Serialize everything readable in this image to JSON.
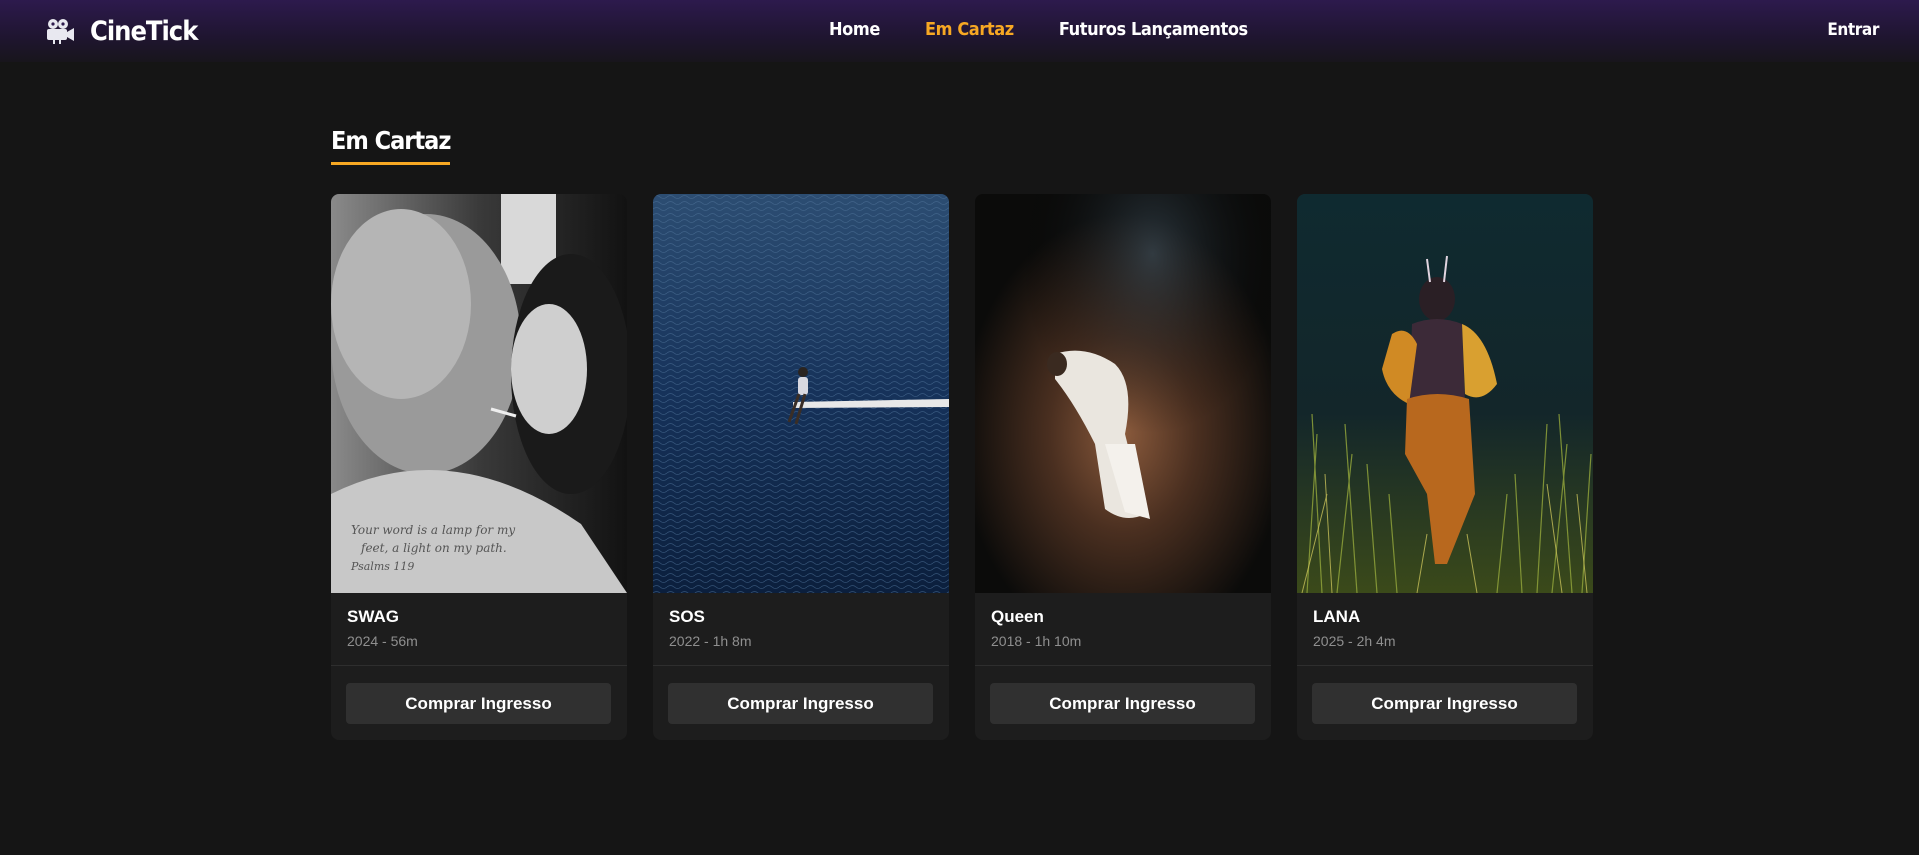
{
  "header": {
    "brand_icon": "film-projector-icon",
    "brand_name": "CineTick",
    "nav": [
      {
        "label": "Home",
        "active": false
      },
      {
        "label": "Em Cartaz",
        "active": true
      },
      {
        "label": "Futuros Lançamentos",
        "active": false
      }
    ],
    "login_label": "Entrar"
  },
  "section": {
    "title": "Em Cartaz"
  },
  "movies": [
    {
      "title": "SWAG",
      "meta": "2024 - 56m",
      "button": "Comprar Ingresso"
    },
    {
      "title": "SOS",
      "meta": "2022 - 1h 8m",
      "button": "Comprar Ingresso"
    },
    {
      "title": "Queen",
      "meta": "2018 - 1h 10m",
      "button": "Comprar Ingresso"
    },
    {
      "title": "LANA",
      "meta": "2025 - 2h 4m",
      "button": "Comprar Ingresso"
    }
  ],
  "colors": {
    "accent": "#f7a823",
    "header_purple": "#2d1a4d",
    "background": "#151515",
    "card": "#1d1d1d",
    "button": "#303030"
  }
}
